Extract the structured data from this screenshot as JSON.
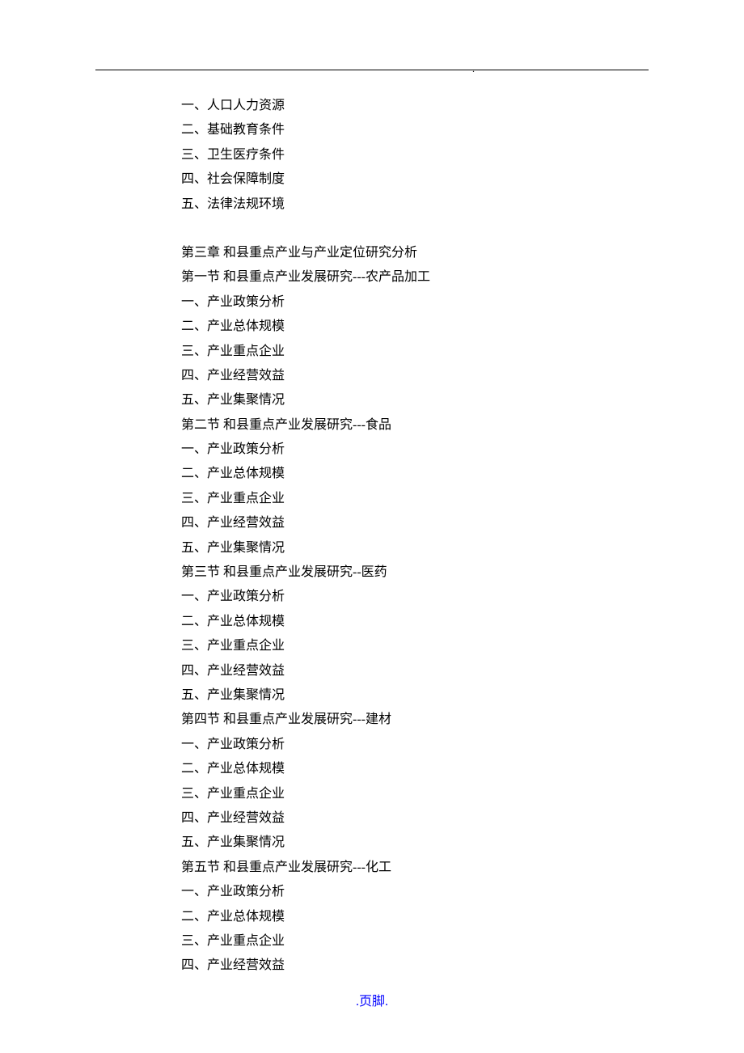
{
  "header_dot": ".",
  "lines": [
    "一、人口人力资源",
    "二、基础教育条件",
    "三、卫生医疗条件",
    "四、社会保障制度",
    "五、法律法规环境"
  ],
  "chapter3_title": "第三章  和县重点产业与产业定位研究分析",
  "sections": [
    {
      "title": "第一节  和县重点产业发展研究---农产品加工",
      "items": [
        "一、产业政策分析",
        "二、产业总体规模",
        "三、产业重点企业",
        "四、产业经营效益",
        "五、产业集聚情况"
      ]
    },
    {
      "title": "第二节  和县重点产业发展研究---食品",
      "items": [
        "一、产业政策分析",
        "二、产业总体规模",
        "三、产业重点企业",
        "四、产业经营效益",
        "五、产业集聚情况"
      ]
    },
    {
      "title": "第三节  和县重点产业发展研究--医药",
      "items": [
        "一、产业政策分析",
        "二、产业总体规模",
        "三、产业重点企业",
        "四、产业经营效益",
        "五、产业集聚情况"
      ]
    },
    {
      "title": "第四节  和县重点产业发展研究---建材",
      "items": [
        "一、产业政策分析",
        "二、产业总体规模",
        "三、产业重点企业",
        "四、产业经营效益",
        "五、产业集聚情况"
      ]
    },
    {
      "title": "第五节  和县重点产业发展研究---化工",
      "items": [
        "一、产业政策分析",
        "二、产业总体规模",
        "三、产业重点企业",
        "四、产业经营效益"
      ]
    }
  ],
  "footer": ".页脚."
}
